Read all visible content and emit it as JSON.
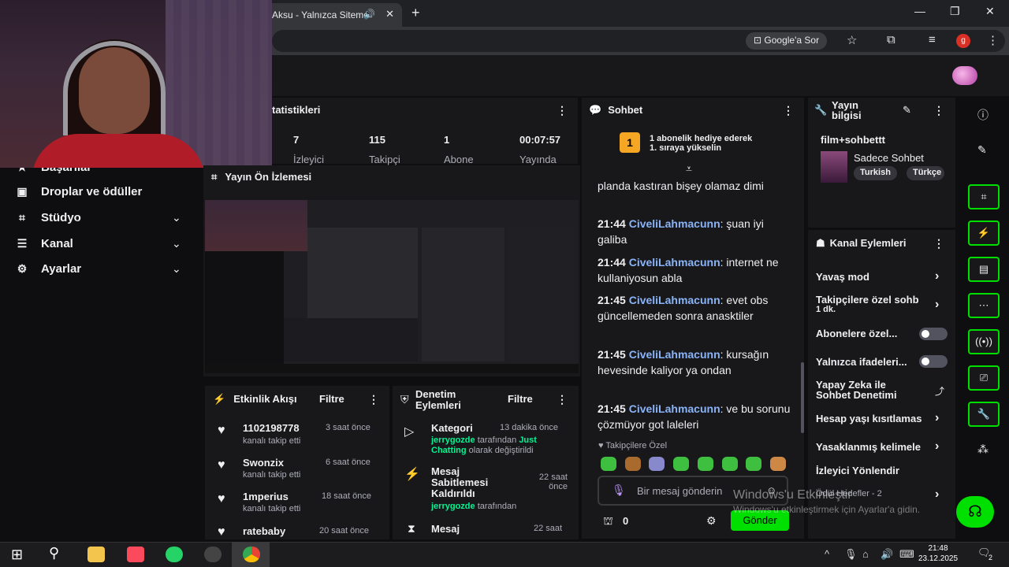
{
  "browser": {
    "tab_title": "Aksu - Yalnızca Siteme",
    "ask_google": "Google'a Sor",
    "profile_initial": "g"
  },
  "sidebar": {
    "partial_item": "Başarılar",
    "items": [
      {
        "label": "Droplar ve ödüller",
        "icon": "gift-icon"
      },
      {
        "label": "Stüdyo",
        "icon": "studio-icon"
      },
      {
        "label": "Kanal",
        "icon": "channel-icon"
      },
      {
        "label": "Ayarlar",
        "icon": "settings-icon"
      }
    ]
  },
  "stats": {
    "title": "tatistikleri",
    "values": [
      {
        "value": "7",
        "label": "İzleyici"
      },
      {
        "value": "115",
        "label": "Takipçi"
      },
      {
        "value": "1",
        "label": "Abone"
      },
      {
        "value": "00:07:57",
        "label": "Yayında"
      }
    ]
  },
  "preview": {
    "title": "Yayın Ön İzlemesi"
  },
  "activity": {
    "title": "Etkinlik Akışı",
    "filter": "Filtre",
    "items": [
      {
        "name": "1102198778",
        "sub": "kanalı takip etti",
        "time": "3 saat önce"
      },
      {
        "name": "Swonzix",
        "sub": "kanalı takip etti",
        "time": "6 saat önce"
      },
      {
        "name": "1mperius",
        "sub": "kanalı takip etti",
        "time": "18 saat önce"
      },
      {
        "name": "ratebaby",
        "sub": "",
        "time": "20 saat önce"
      }
    ]
  },
  "moderation": {
    "title_line1": "Denetim",
    "title_line2": "Eylemleri",
    "filter": "Filtre",
    "items": [
      {
        "title": "Kategori",
        "time": "13 dakika önce",
        "user": "jerrygozde",
        "mid": "tarafından",
        "green2": "Just Chatting",
        "tail": "olarak değiştirildi"
      },
      {
        "title": "Mesaj Sabitlemesi Kaldırıldı",
        "time": "22 saat önce",
        "user": "jerrygozde",
        "mid": "tarafından"
      },
      {
        "title": "Mesaj",
        "time": "22 saat"
      }
    ]
  },
  "chat": {
    "title": "Sohbet",
    "gift_line1": "1 abonelik hediye ederek",
    "gift_line2": "1. sıraya yükselin",
    "gift_rank": "1",
    "first_text": "planda kastıran bişey olamaz dimi",
    "messages": [
      {
        "time": "21:44",
        "user": "CiveliLahmacunn",
        "text": "şuan iyi galiba"
      },
      {
        "time": "21:44",
        "user": "CiveliLahmacunn",
        "text": "internet ne kullaniyosun abla"
      },
      {
        "time": "21:45",
        "user": "CiveliLahmacunn",
        "text": "evet obs güncellemeden sonra anasktiler"
      },
      {
        "time": "21:45",
        "user": "CiveliLahmacunn",
        "text": "kursağın hevesinde kaliyor ya ondan"
      },
      {
        "time": "21:45",
        "user": "CiveliLahmacunn",
        "text": "ve bu sorunu çözmüyor got laleleri"
      }
    ],
    "followers_only": "Takipçilere Özel",
    "input_placeholder": "Bir mesaj gönderin",
    "points": "0",
    "send": "Gönder"
  },
  "stream_info": {
    "title_line1": "Yayın",
    "title_line2": "bilgisi",
    "stream_title": "film+sohbettt",
    "category": "Sadece Sohbet",
    "tags": [
      "Turkish",
      "Türkçe"
    ]
  },
  "channel_actions": {
    "title": "Kanal Eylemleri",
    "slow_mode": "Yavaş mod",
    "followers_chat": "Takipçilere özel sohb",
    "followers_chat_sub": "1 dk.",
    "subs_only": "Abonelere özel...",
    "emotes_only": "Yalnızca ifadeleri...",
    "ai_mod_line1": "Yapay Zeka ile",
    "ai_mod_line2": "Sohbet Denetimi",
    "account_age": "Hesap yaşı kısıtlamas",
    "banned_words": "Yasaklanmış kelimele",
    "raid": "İzleyici Yönlendir",
    "rewards": "Ödül Hedefler - 2"
  },
  "watermark": {
    "line1": "Windows'u Etkinleştir",
    "line2": "Windows'u etkinleştirmek için Ayarlar'a gidin."
  },
  "taskbar": {
    "time": "21:48",
    "date": "23.12.2025",
    "notif_count": "2"
  }
}
